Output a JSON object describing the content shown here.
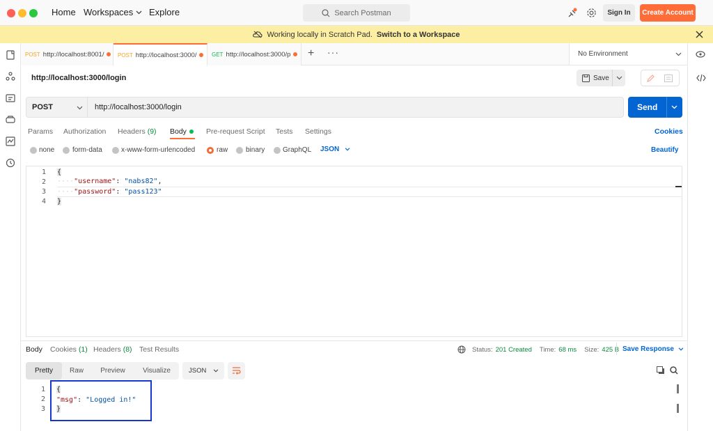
{
  "titlebar": {
    "nav": {
      "home": "Home",
      "workspaces": "Workspaces",
      "explore": "Explore"
    },
    "search_placeholder": "Search Postman",
    "sign_in": "Sign In",
    "create_account": "Create Account"
  },
  "banner": {
    "text": "Working locally in Scratch Pad.",
    "link": "Switch to a Workspace"
  },
  "tabs": [
    {
      "method": "POST",
      "url": "http://localhost:8001/"
    },
    {
      "method": "POST",
      "url": "http://localhost:3000/"
    },
    {
      "method": "GET",
      "url": "http://localhost:3000/p"
    }
  ],
  "environment": "No Environment",
  "request": {
    "title": "http://localhost:3000/login",
    "save_label": "Save",
    "method": "POST",
    "url": "http://localhost:3000/login",
    "send_label": "Send"
  },
  "request_tabs": {
    "params": "Params",
    "authorization": "Authorization",
    "headers": "Headers",
    "headers_count": "(9)",
    "body": "Body",
    "prerequest": "Pre-request Script",
    "tests": "Tests",
    "settings": "Settings",
    "cookies": "Cookies"
  },
  "body_types": {
    "none": "none",
    "form_data": "form-data",
    "urlencoded": "x-www-form-urlencoded",
    "raw": "raw",
    "binary": "binary",
    "graphql": "GraphQL",
    "format": "JSON",
    "beautify": "Beautify"
  },
  "request_body": {
    "line_numbers": [
      "1",
      "2",
      "3",
      "4"
    ],
    "open": "{",
    "close": "}",
    "fields": [
      {
        "key": "\"username\"",
        "value": "\"nabs82\"",
        "sep": ": ",
        "end": ","
      },
      {
        "key": "\"password\"",
        "value": "\"pass123\"",
        "sep": ": ",
        "end": ""
      }
    ]
  },
  "response_tabs": {
    "body": "Body",
    "cookies": "Cookies",
    "cookies_count": "(1)",
    "headers": "Headers",
    "headers_count": "(8)",
    "test_results": "Test Results"
  },
  "response_status": {
    "status_label": "Status:",
    "status_value": "201 Created",
    "time_label": "Time:",
    "time_value": "68 ms",
    "size_label": "Size:",
    "size_value": "425 B",
    "save_response": "Save Response"
  },
  "view_tabs": {
    "pretty": "Pretty",
    "raw": "Raw",
    "preview": "Preview",
    "visualize": "Visualize",
    "format": "JSON"
  },
  "response_body": {
    "line_numbers": [
      "1",
      "2",
      "3"
    ],
    "open": "{",
    "close": "}",
    "key": "\"msg\"",
    "sep": ": ",
    "value": "\"Logged in!\""
  },
  "colors": {
    "accent": "#ff6c37",
    "send": "#0265d2",
    "banner": "#fcefa4",
    "status_ok": "#0a8c3c"
  }
}
